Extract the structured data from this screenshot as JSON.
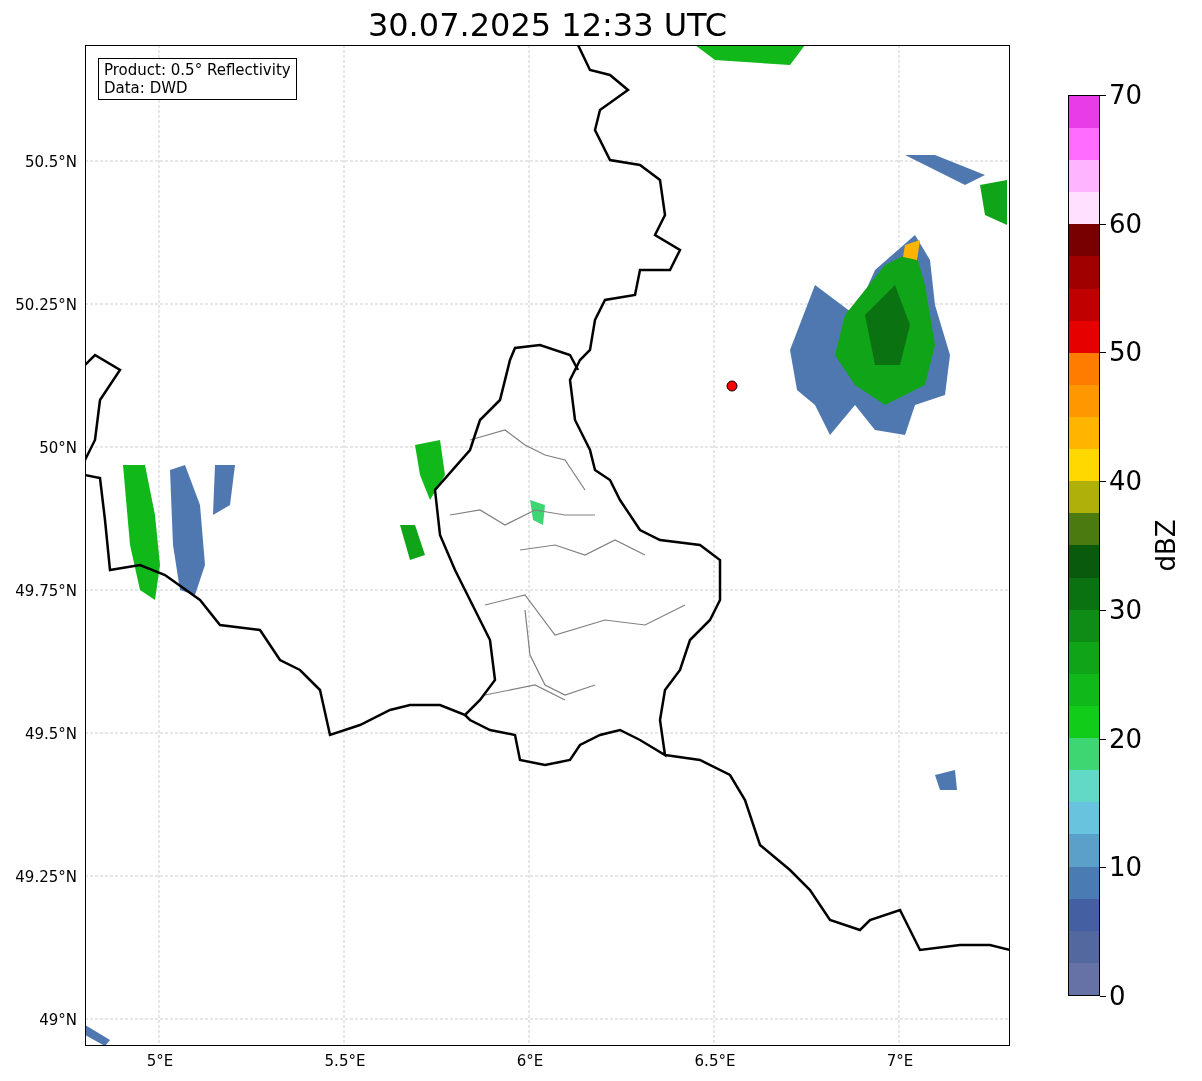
{
  "title": "30.07.2025 12:33 UTC",
  "legend": [
    "Product: 0.5° Reflectivity",
    "Data: DWD"
  ],
  "y_ticks": [
    "50.5°N",
    "50.25°N",
    "50°N",
    "49.75°N",
    "49.5°N",
    "49.25°N",
    "49°N"
  ],
  "x_ticks": [
    "5°E",
    "5.5°E",
    "6°E",
    "6.5°E",
    "7°E"
  ],
  "colorbar": {
    "label": "dBZ",
    "ticks": [
      "70",
      "60",
      "50",
      "40",
      "30",
      "20",
      "10",
      "0"
    ]
  }
}
